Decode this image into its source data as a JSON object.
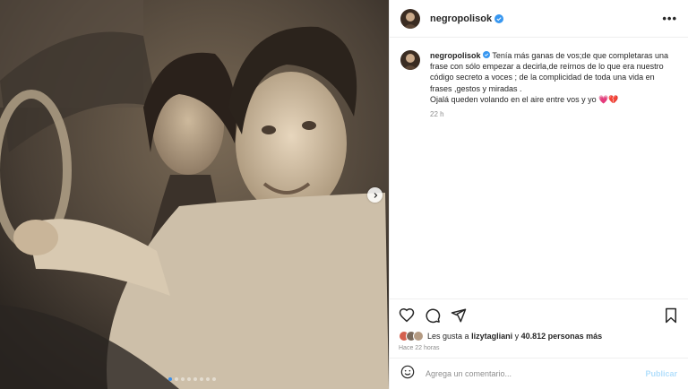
{
  "post": {
    "username": "negropolisok",
    "verified": true,
    "more_icon": "more-horizontal-icon",
    "caption_text": "Tenía más ganas de vos;de que completaras una frase con sólo empezar a decirla,de reírnos de lo que era nuestro código secreto a voces ; de la complicidad de toda una vida en frases ,gestos y miradas .",
    "caption_line2": "Ojalá queden volando en el aire entre vos y yo 💗💔",
    "caption_time": "22 h",
    "carousel": {
      "current": 1,
      "total": 8
    },
    "actions": {
      "like_icon": "heart-icon",
      "comment_icon": "comment-icon",
      "share_icon": "send-icon",
      "save_icon": "bookmark-icon"
    },
    "likes": {
      "prefix": "Les gusta a",
      "user": "lizytagliani",
      "connector": "y",
      "count_text": "40.812 personas más"
    },
    "date": "Hace 22 horas",
    "comment": {
      "placeholder": "Agrega un comentario...",
      "emoji_icon": "emoji-icon",
      "publish_label": "Publicar"
    }
  },
  "colors": {
    "link_blue": "#0095f6",
    "publish_disabled": "#b2dffc",
    "verified_blue": "#3897f0",
    "secondary_text": "#8e8e8e"
  }
}
